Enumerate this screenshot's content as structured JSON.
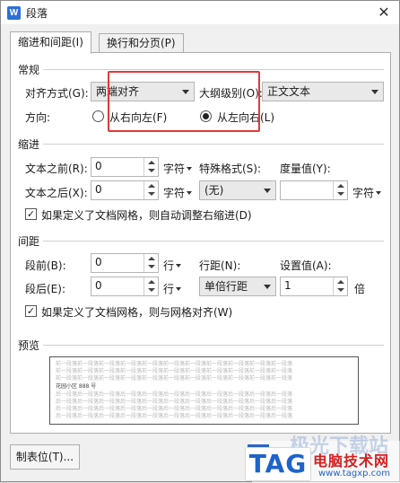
{
  "window": {
    "title": "段落",
    "close_glyph": "✕",
    "app_icon_glyph": "W"
  },
  "tabs": [
    {
      "label": "缩进和间距(I)",
      "active": true
    },
    {
      "label": "换行和分页(P)",
      "active": false
    }
  ],
  "general": {
    "title": "常规",
    "alignment_label": "对齐方式(G):",
    "alignment_value": "两端对齐",
    "outline_label": "大纲级别(O):",
    "outline_value": "正文文本",
    "direction_label": "方向:",
    "rtl_label": "从右向左(F)",
    "ltr_label": "从左向右(L)"
  },
  "indent": {
    "title": "缩进",
    "before_label": "文本之前(R):",
    "before_value": "0",
    "before_unit": "字符",
    "after_label": "文本之后(X):",
    "after_value": "0",
    "after_unit": "字符",
    "special_label": "特殊格式(S):",
    "special_value": "(无)",
    "measure_label": "度量值(Y):",
    "measure_value": "",
    "measure_unit": "字符",
    "grid_check_label": "如果定义了文档网格，则自动调整右缩进(D)"
  },
  "spacing": {
    "title": "间距",
    "before_label": "段前(B):",
    "before_value": "0",
    "before_unit": "行",
    "after_label": "段后(E):",
    "after_value": "0",
    "after_unit": "行",
    "line_label": "行距(N):",
    "line_value": "单倍行距",
    "setting_label": "设置值(A):",
    "setting_value": "1",
    "setting_unit": "倍",
    "grid_check_label": "如果定义了文档网格，则与网格对齐(W)"
  },
  "preview": {
    "title": "预览",
    "line_prev": "前一段落前一段落前一段落前一段落前一段落前一段落前一段落前一段落前一段落前一段落前一段落",
    "sample_text": "花园小区 888 号",
    "line_next": "后一段落后一段落后一段落后一段落后一段落后一段落后一段落后一段落后一段落后一段落后一段落"
  },
  "footer": {
    "tabs_button": "制表位(T)..."
  },
  "watermark": {
    "tag": "TAG",
    "faded": "极光下载站",
    "name": "电脑技术网",
    "url": "www.tagxp.com"
  },
  "colors": {
    "highlight": "#e03a3a",
    "accent": "#2f6fd6"
  }
}
